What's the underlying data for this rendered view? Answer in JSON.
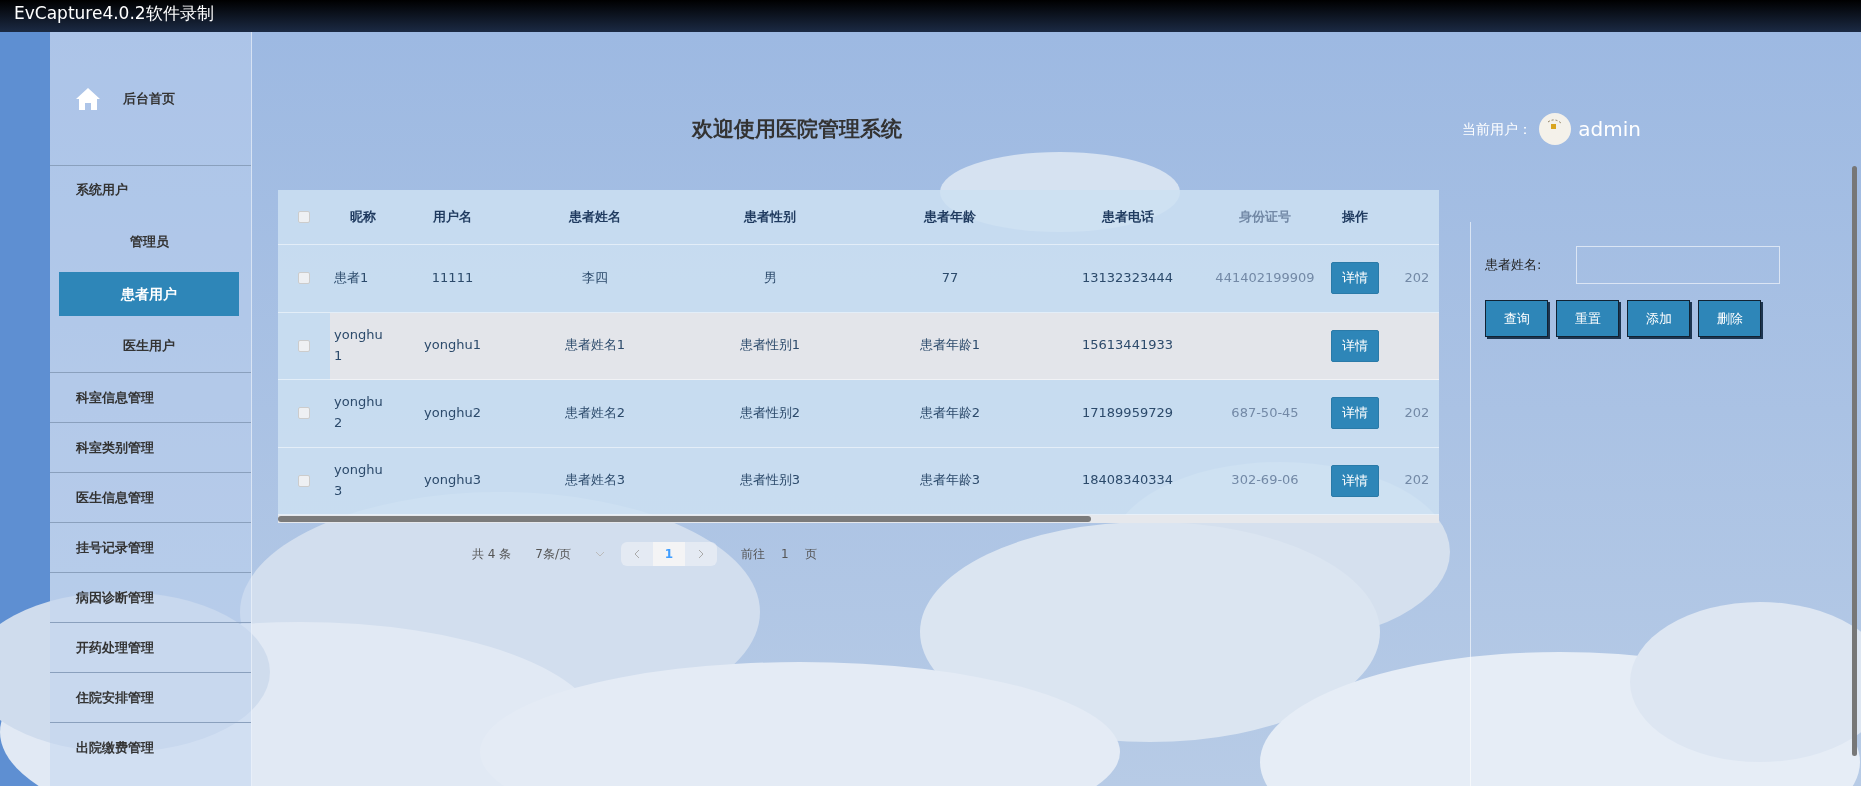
{
  "window": {
    "title": "EvCapture4.0.2软件录制"
  },
  "sidebar": {
    "home": {
      "label": "后台首页"
    },
    "items": [
      {
        "label": "系统用户",
        "children": [
          {
            "label": "管理员",
            "selected": false
          },
          {
            "label": "患者用户",
            "selected": true
          },
          {
            "label": "医生用户",
            "selected": false
          }
        ]
      },
      {
        "label": "科室信息管理",
        "selected": false
      },
      {
        "label": "科室类别管理",
        "selected": false
      },
      {
        "label": "医生信息管理",
        "selected": false
      },
      {
        "label": "挂号记录管理",
        "selected": false
      },
      {
        "label": "病因诊断管理",
        "selected": false
      },
      {
        "label": "开药处理管理",
        "selected": false
      },
      {
        "label": "住院安排管理",
        "selected": false
      },
      {
        "label": "出院缴费管理",
        "selected": false
      }
    ]
  },
  "header": {
    "title": "欢迎使用医院管理系统",
    "user_label": "当前用户：",
    "username": "admin"
  },
  "table": {
    "header_checked": false,
    "columns": [
      {
        "label": "昵称"
      },
      {
        "label": "用户名"
      },
      {
        "label": "患者姓名"
      },
      {
        "label": "患者性别"
      },
      {
        "label": "患者年龄"
      },
      {
        "label": "患者电话"
      },
      {
        "label": "身份证号"
      },
      {
        "label": "操作"
      },
      {}
    ],
    "rows": [
      {
        "checked": false,
        "highlighted": false,
        "cells": [
          "患者1",
          "11111",
          "李四",
          "男",
          "77",
          "13132323444",
          "441402199909",
          "详情",
          "202"
        ]
      },
      {
        "checked": false,
        "highlighted": true,
        "cells": [
          "yonghu1",
          "yonghu1",
          "患者姓名1",
          "患者性别1",
          "患者年龄1",
          "15613441933",
          null,
          "详情",
          null
        ]
      },
      {
        "checked": false,
        "highlighted": false,
        "cells": [
          "yonghu2",
          "yonghu2",
          "患者姓名2",
          "患者性别2",
          "患者年龄2",
          "17189959729",
          "687-50-45",
          "详情",
          "202"
        ]
      },
      {
        "checked": false,
        "highlighted": false,
        "cells": [
          "yonghu3",
          "yonghu3",
          "患者姓名3",
          "患者性别3",
          "患者年龄3",
          "18408340334",
          "302-69-06",
          "详情",
          "202"
        ]
      }
    ]
  },
  "pagination": {
    "total": "共 4 条",
    "page_size": "7条/页",
    "pages": [
      {
        "label": "1",
        "selected": true
      }
    ],
    "goto_label": "前往",
    "goto_value": "1",
    "page_suffix": "页"
  },
  "search": {
    "label": "患者姓名:",
    "buttons": [
      "查询",
      "重置",
      "添加",
      "删除"
    ]
  }
}
